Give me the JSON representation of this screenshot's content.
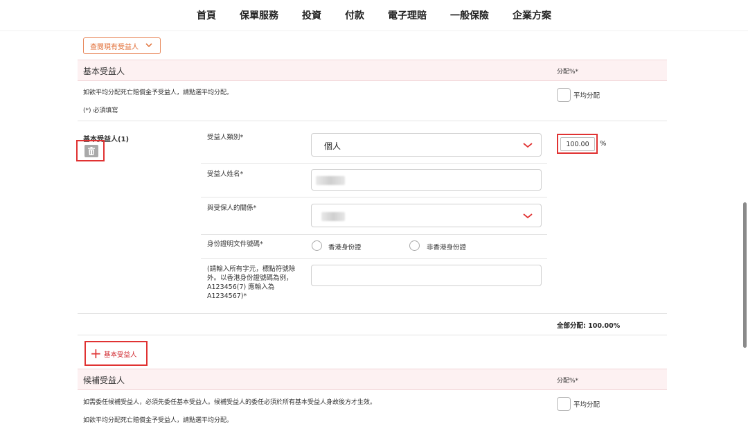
{
  "nav": {
    "items": [
      "首頁",
      "保單服務",
      "投資",
      "付款",
      "電子理賠",
      "一般保險",
      "企業方案"
    ]
  },
  "view_existing": {
    "label": "查閱現有受益人"
  },
  "basic_section": {
    "title": "基本受益人",
    "pct_header": "分配%*",
    "desc_even": "如欲平均分配死亡賠償金予受益人，請點選平均分配。",
    "desc_required": "(*) 必須填寫",
    "even_label": "平均分配"
  },
  "beneficiary": {
    "title": "基本受益人(1)",
    "type_label": "受益人類別*",
    "type_value": "個人",
    "name_label": "受益人姓名*",
    "relation_label": "與受保人的關係*",
    "id_label": "身份證明文件號碼*",
    "id_opt_hk": "香港身份證",
    "id_opt_non_hk": "非香港身份證",
    "id_hint": "(請輸入所有字元，標點符號除外。以香港身份證號碼為例，A123456(7) 應輸入為A1234567)*",
    "allocation": "100.00",
    "pct_sign": "%"
  },
  "total_alloc": "全部分配: 100.00%",
  "add_basic": {
    "label": "基本受益人"
  },
  "contingent_section": {
    "title": "候補受益人",
    "pct_header": "分配%*",
    "desc_1": "如需委任候補受益人，必須先委任基本受益人。候補受益人的委任必須於所有基本受益人身故後方才生效。",
    "desc_2": "如欲平均分配死亡賠償金予受益人，請點選平均分配。",
    "even_label": "平均分配"
  },
  "colors": {
    "accent_red": "#e03232",
    "header_bg": "#fdf1f2",
    "orange": "#e06a30"
  }
}
